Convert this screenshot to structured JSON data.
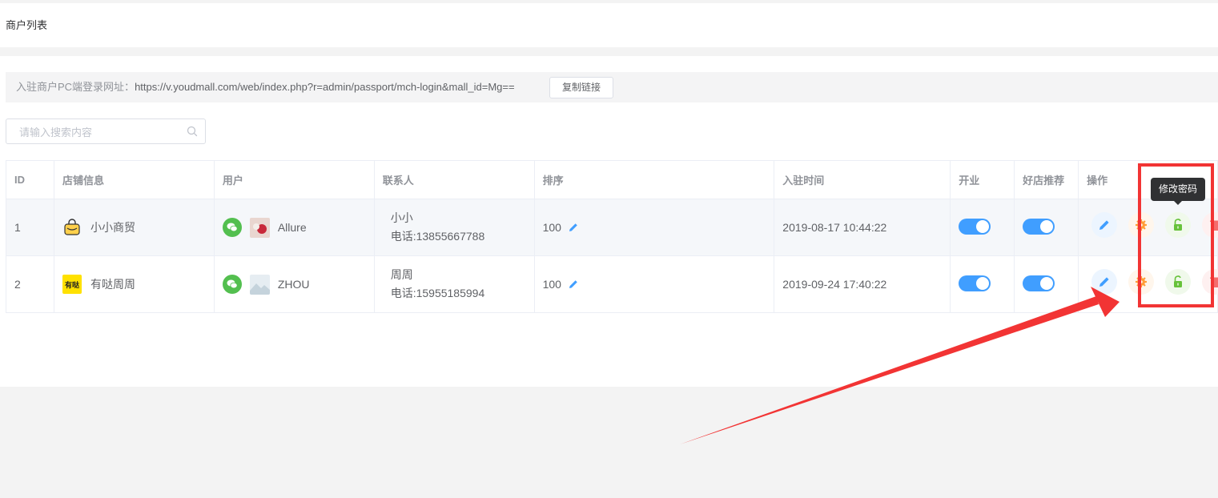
{
  "header": {
    "title": "商户列表"
  },
  "notice": {
    "label": "入驻商户PC端登录网址：",
    "url": "https://v.youdmall.com/web/index.php?r=admin/passport/mch-login&mall_id=Mg==",
    "copy_label": "复制链接"
  },
  "search": {
    "placeholder": "请输入搜索内容",
    "value": ""
  },
  "table": {
    "headers": {
      "id": "ID",
      "shop": "店铺信息",
      "user": "用户",
      "contact": "联系人",
      "sort": "排序",
      "join_time": "入驻时间",
      "open": "开业",
      "recommend": "好店推荐",
      "actions": "操作"
    },
    "rows": [
      {
        "id": "1",
        "shop_name": "小小商贸",
        "shop_logo": "shopping-bag-logo",
        "user_name": "Allure",
        "contact_name": "小小",
        "contact_phone": "电话:13855667788",
        "sort": "100",
        "join_time": "2019-08-17 10:44:22",
        "open": true,
        "recommend": true
      },
      {
        "id": "2",
        "shop_name": "有哒周周",
        "shop_logo": "yellow-text-logo",
        "user_name": "ZHOU",
        "contact_name": "周周",
        "contact_phone": "电话:15955185994",
        "sort": "100",
        "join_time": "2019-09-24 17:40:22",
        "open": true,
        "recommend": true
      }
    ]
  },
  "tooltip": {
    "text": "修改密码"
  },
  "colors": {
    "primary": "#409eff",
    "wechat": "#53bf4f",
    "unlock": "#67c23a",
    "setting": "#ff9d37",
    "delete": "#f56c6c",
    "annotation": "#f23434"
  }
}
